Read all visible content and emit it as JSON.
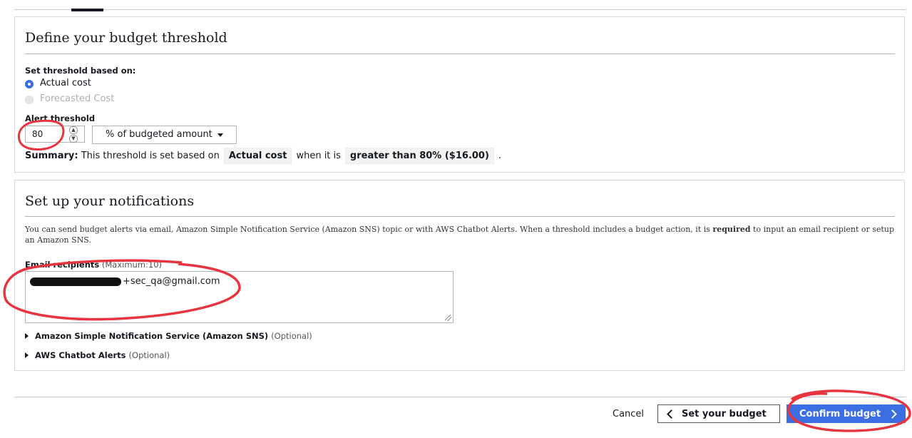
{
  "threshold": {
    "title": "Define your budget threshold",
    "based_on_label": "Set threshold based on:",
    "options": [
      {
        "label": "Actual cost",
        "selected": true
      },
      {
        "label": "Forecasted Cost",
        "selected": false
      }
    ],
    "alert_label": "Alert threshold",
    "alert_value": "80",
    "unit_select": "% of budgeted amount",
    "summary": {
      "prefix": "Summary:",
      "text1": "This threshold is set based on",
      "basis": "Actual cost",
      "text2": "when it is",
      "condition": "greater than 80% ($16.00)",
      "suffix": "."
    }
  },
  "notifications": {
    "title": "Set up your notifications",
    "description_pre": "You can send budget alerts via email, Amazon Simple Notification Service (Amazon SNS) topic or with AWS Chatbot Alerts. When a threshold includes a budget action, it is ",
    "description_bold": "required",
    "description_post": " to input an email recipient or setup an Amazon SNS.",
    "email_label": "Email recipients",
    "email_hint": "(Maximum:10)",
    "email_value": "+sec_qa@gmail.com",
    "sns_label": "Amazon Simple Notification Service (Amazon SNS)",
    "sns_optional": "(Optional)",
    "chatbot_label": "AWS Chatbot Alerts",
    "chatbot_optional": "(Optional)"
  },
  "footer": {
    "cancel": "Cancel",
    "back": "Set your budget",
    "confirm": "Confirm budget"
  },
  "colors": {
    "primary": "#3b6ee3",
    "annotation": "#e8343f"
  }
}
